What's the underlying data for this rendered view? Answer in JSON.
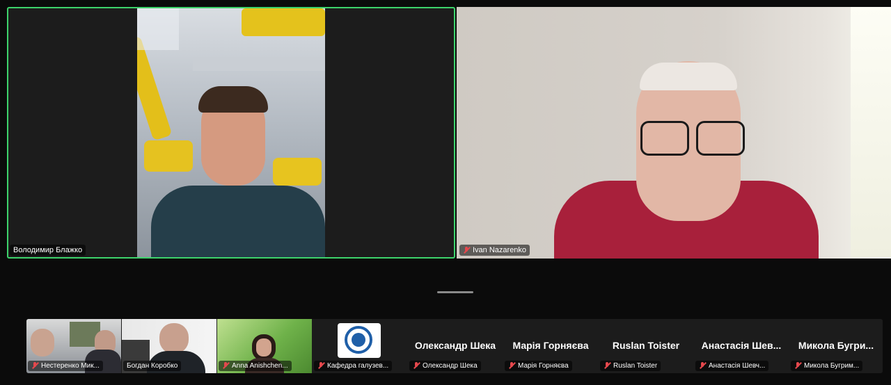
{
  "meeting": {
    "active_speaker": {
      "name": "Володимир Блажко",
      "muted": false,
      "highlight_color": "#3dd36b"
    },
    "second_tile": {
      "name": "Ivan Nazarenko",
      "muted": true
    }
  },
  "participants": [
    {
      "name": "Нестеренко Мик...",
      "muted": true,
      "video": true
    },
    {
      "name": "Богдан Коробко",
      "muted": false,
      "video": true
    },
    {
      "name": "Anna Anishchen...",
      "muted": true,
      "video": true
    },
    {
      "name": "Кафедра галузев...",
      "muted": true,
      "video": true
    },
    {
      "name": "Олександр Шека",
      "display_name": "Олександр Шека",
      "muted": true,
      "video": false
    },
    {
      "name": "Марія Горняєва",
      "display_name": "Марія Горняєва",
      "muted": true,
      "video": false
    },
    {
      "name": "Ruslan Toister",
      "display_name": "Ruslan Toister",
      "muted": true,
      "video": false
    },
    {
      "name": "Анастасія Шевч...",
      "display_name": "Анастасія Шев...",
      "muted": true,
      "video": false
    },
    {
      "name": "Микола Бугрим...",
      "display_name": "Микола Бугри...",
      "muted": true,
      "video": false
    }
  ],
  "colors": {
    "mute_red": "#e5484d",
    "background": "#0b0b0b",
    "tile_bg": "#1c1c1c"
  }
}
